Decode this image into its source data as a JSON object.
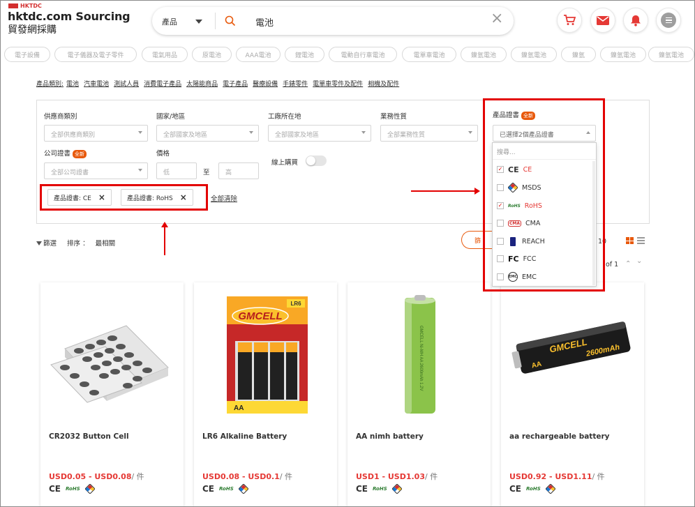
{
  "header": {
    "logo_top": "HKTDC",
    "logo_main": "hktdc.com Sourcing",
    "logo_sub": "貿發網採購",
    "search": {
      "category": "產品",
      "query": "電池"
    }
  },
  "chips": [
    "電子設備",
    "電子儀器及電子零件",
    "電氣用品",
    "原電池",
    "AAA電池",
    "鋰電池",
    "電動自行車電池",
    "電單車電池",
    "鎳氫電池",
    "鎳氫電池",
    "鎳氫",
    "鎳氫電池",
    "鎳氫電池"
  ],
  "categories": {
    "label": "產品類別:",
    "items": [
      "電池",
      "汽車電池",
      "測試人員",
      "消費電子產品",
      "太陽能商品",
      "電子產品",
      "醫療設備",
      "手錶零件",
      "電單車零件及配件",
      "相機及配件"
    ]
  },
  "filters": {
    "supplier_type": {
      "label": "供應商類別",
      "placeholder": "全部供應商類別"
    },
    "country": {
      "label": "國家/地區",
      "placeholder": "全部國家及地區"
    },
    "factory": {
      "label": "工廠所在地",
      "placeholder": "全部國家及地區"
    },
    "business": {
      "label": "業務性質",
      "placeholder": "全部業務性質"
    },
    "product_cert": {
      "label": "產品證書",
      "badge": "全新",
      "placeholder": "已選擇2個產品證書"
    },
    "company_cert": {
      "label": "公司證書",
      "badge": "全新",
      "placeholder": "全部公司證書"
    },
    "price": {
      "label": "價格",
      "low": "低",
      "to": "至",
      "high": "高"
    },
    "online": {
      "label": "線上購買"
    },
    "tags": [
      {
        "text": "產品證書: CE",
        "x": "×"
      },
      {
        "text": "產品證書: RoHS",
        "x": "×"
      }
    ],
    "clear_all": "全部清除"
  },
  "dropdown": {
    "search_placeholder": "搜尋...",
    "items": [
      {
        "icon": "CE",
        "label": "CE",
        "checked": true
      },
      {
        "icon": "",
        "label": "MSDS",
        "checked": false
      },
      {
        "icon": "RoHS",
        "label": "RoHS",
        "checked": true
      },
      {
        "icon": "CMA",
        "label": "CMA",
        "checked": false
      },
      {
        "icon": "",
        "label": "REACH",
        "checked": false
      },
      {
        "icon": "FC",
        "label": "FCC",
        "checked": false
      },
      {
        "icon": "EMC",
        "label": "EMC",
        "checked": false
      }
    ]
  },
  "sort": {
    "filter": "篩選",
    "sort_label": "排序 ：",
    "sort_value": "最相關"
  },
  "pager": {
    "btn": "篩",
    "count": "10",
    "page": "of 1"
  },
  "products": [
    {
      "name": "CR2032 Button Cell",
      "price": "USD0.05 - USD0.08",
      "unit": "/ 件"
    },
    {
      "name": "LR6 Alkaline Battery",
      "price": "USD0.08 - USD0.1",
      "unit": "/ 件"
    },
    {
      "name": "AA nimh battery",
      "price": "USD1 - USD1.03",
      "unit": "/ 件"
    },
    {
      "name": "aa rechargeable battery",
      "price": "USD0.92 - USD1.11",
      "unit": "/ 件"
    }
  ],
  "cert_icons": {
    "ce": "CE",
    "rohs": "RoHS"
  },
  "images": {
    "gmcell_brand": "GMCELL",
    "gmcell_lr6": "LR6",
    "gmcell_aa": "AA",
    "aa_nimh_label": "GMCELL Ni-MH AA 2600mAh 1.2V",
    "aa_rech_mah": "2600mAh"
  },
  "colors": {
    "accent": "#e8590c",
    "red": "#e30000",
    "price": "#e53935"
  }
}
